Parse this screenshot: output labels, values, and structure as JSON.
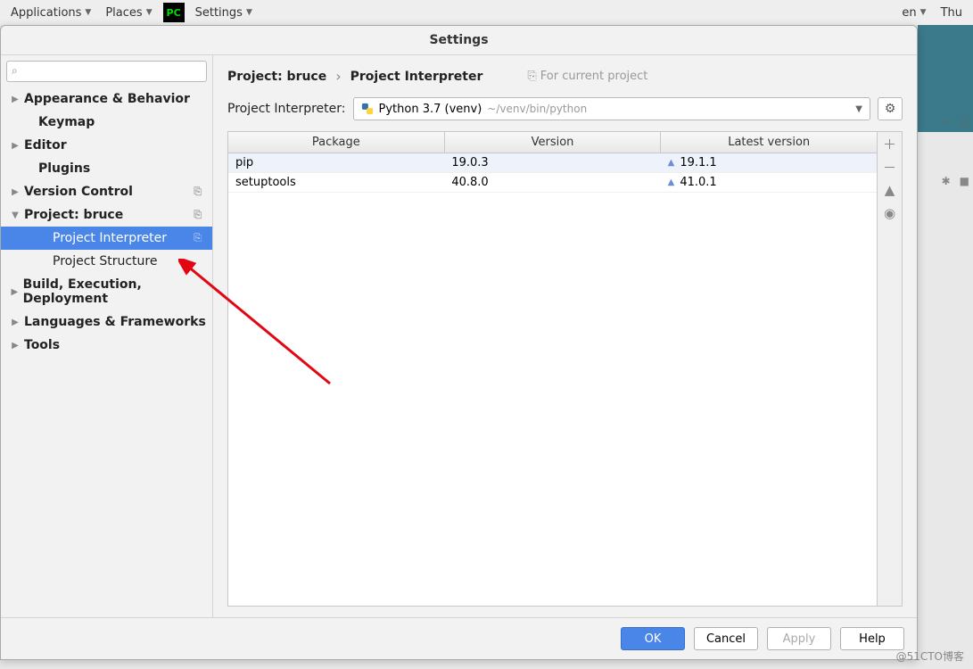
{
  "topbar": {
    "applications": "Applications",
    "places": "Places",
    "settings": "Settings",
    "lang": "en",
    "day": "Thu"
  },
  "dialog": {
    "title": "Settings"
  },
  "sidebar": {
    "items": [
      {
        "label": "Appearance & Behavior",
        "bold": true,
        "arrow": "▶"
      },
      {
        "label": "Keymap",
        "bold": true,
        "indent": 1
      },
      {
        "label": "Editor",
        "bold": true,
        "arrow": "▶"
      },
      {
        "label": "Plugins",
        "bold": true,
        "indent": 1
      },
      {
        "label": "Version Control",
        "bold": true,
        "arrow": "▶",
        "badge": "⎘"
      },
      {
        "label": "Project: bruce",
        "bold": true,
        "arrow": "▼",
        "badge": "⎘"
      },
      {
        "label": "Project Interpreter",
        "indent": 2,
        "selected": true,
        "badge": "⎘"
      },
      {
        "label": "Project Structure",
        "indent": 2
      },
      {
        "label": "Build, Execution, Deployment",
        "bold": true,
        "arrow": "▶"
      },
      {
        "label": "Languages & Frameworks",
        "bold": true,
        "arrow": "▶"
      },
      {
        "label": "Tools",
        "bold": true,
        "arrow": "▶"
      }
    ]
  },
  "breadcrumb": {
    "crumb1": "Project: bruce",
    "crumb2": "Project Interpreter",
    "hint": "For current project"
  },
  "interpreter": {
    "label": "Project Interpreter:",
    "name": "Python 3.7 (venv)",
    "path": "~/venv/bin/python"
  },
  "table": {
    "headers": {
      "pkg": "Package",
      "ver": "Version",
      "lat": "Latest version"
    },
    "rows": [
      {
        "pkg": "pip",
        "ver": "19.0.3",
        "lat": "19.1.1",
        "update": true,
        "selected": true
      },
      {
        "pkg": "setuptools",
        "ver": "40.8.0",
        "lat": "41.0.1",
        "update": true
      }
    ]
  },
  "buttons": {
    "ok": "OK",
    "cancel": "Cancel",
    "apply": "Apply",
    "help": "Help"
  },
  "watermark": "@51CTO博客"
}
